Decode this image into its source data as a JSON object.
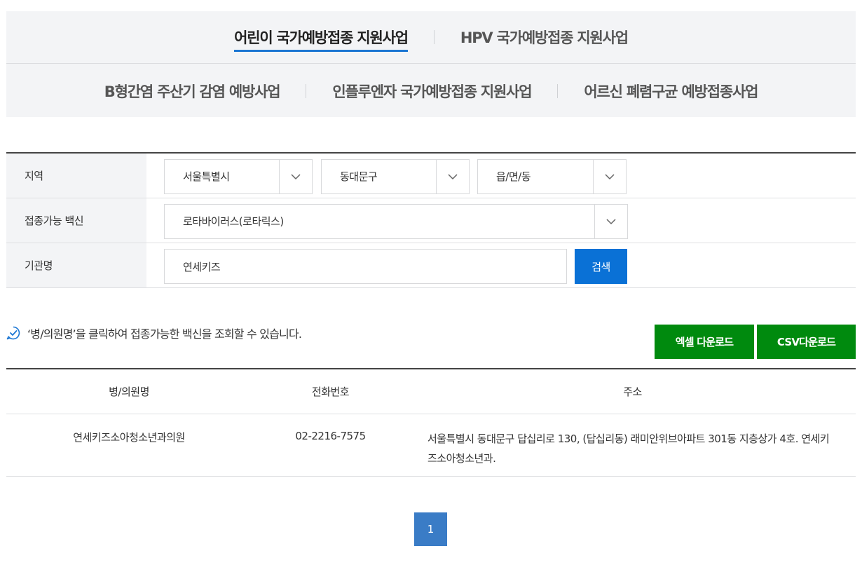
{
  "tabs": {
    "row1": [
      "어린이 국가예방접종 지원사업",
      "HPV 국가예방접종 지원사업"
    ],
    "row2": [
      "B형간염 주산기 감염 예방사업",
      "인플루엔자 국가예방접종 지원사업",
      "어르신 폐렴구균 예방접종사업"
    ],
    "active": "어린이 국가예방접종 지원사업"
  },
  "form": {
    "region_label": "지역",
    "sido": "서울특별시",
    "sigungu": "동대문구",
    "dong": "읍/면/동",
    "vaccine_label": "접종가능 백신",
    "vaccine": "로타바이러스(로타릭스)",
    "org_label": "기관명",
    "org_value": "연세키즈",
    "search_label": "검색"
  },
  "info": {
    "message": "‘병/의원명’을 클릭하여 접종가능한 백신을 조회할 수 있습니다.",
    "excel_label": "엑셀 다운로드",
    "csv_label": "CSV다운로드",
    "accent": "#008a0e"
  },
  "table": {
    "headers": [
      "병/의원명",
      "전화번호",
      "주소"
    ],
    "rows": [
      {
        "name": "연세키즈소아청소년과의원",
        "phone": "02-2216-7575",
        "address": "서울특별시 동대문구 답십리로 130, (답십리동) 래미안위브아파트 301동 지층상가 4호. 연세키즈소아청소년과."
      }
    ]
  },
  "pagination": {
    "current": "1"
  },
  "icons": {
    "select_arrow": "chevron-down-icon",
    "info": "check-circle-icon"
  },
  "colors": {
    "primary": "#0a71d6",
    "tab_underline": "#1b76d3",
    "page_active": "#3a7cc6"
  }
}
